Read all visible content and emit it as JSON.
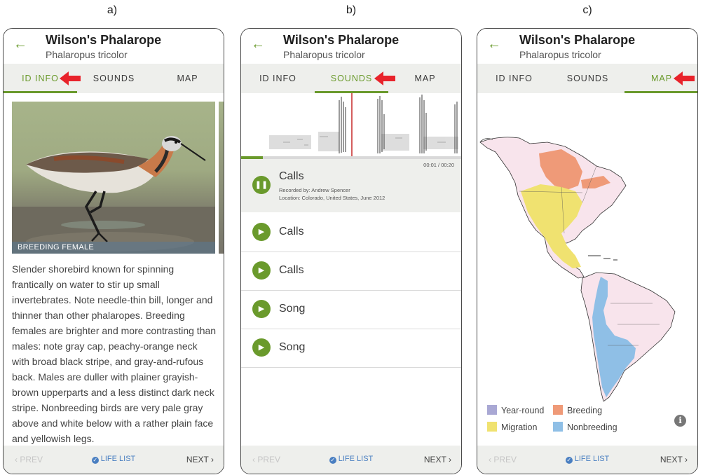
{
  "captions": [
    "a)",
    "b)",
    "c)"
  ],
  "bird": {
    "name": "Wilson's Phalarope",
    "scientific": "Phalaropus tricolor"
  },
  "icons": {
    "back": "←",
    "chevron_left": "‹",
    "chevron_right": "›",
    "check": "✓",
    "pause": "❚❚",
    "play": "▶",
    "info": "i"
  },
  "tabs": [
    "ID INFO",
    "SOUNDS",
    "MAP"
  ],
  "footer": {
    "prev": "PREV",
    "life_list": "LIFE LIST",
    "next": "NEXT"
  },
  "colors": {
    "accent": "#6a9a2c",
    "arrow": "#e8232b",
    "life_list": "#4a7fc1",
    "year_round": "#a9a8d4",
    "breeding": "#ef9a78",
    "migration": "#f0e270",
    "nonbreeding": "#8fbfe6"
  },
  "panel_a": {
    "photo_label": "BREEDING FEMALE",
    "description": "Slender shorebird known for spinning frantically on water to stir up small invertebrates. Note needle-thin bill, longer and thinner than other phalaropes. Breeding females are brighter and more contrasting than males: note gray cap, peachy-orange neck with broad black stripe, and gray-and-rufous back. Males are duller with plainer grayish-brown upperparts and a less distinct dark neck stripe. Nonbreeding birds are very pale gray above and white below with a rather plain face and yellowish legs."
  },
  "panel_b": {
    "playback": {
      "elapsed": "00:01",
      "total": "00:20",
      "progress": 0.1
    },
    "now_playing": {
      "title": "Calls",
      "recorded_by": "Recorded by: Andrew Spencer",
      "location": "Location: Colorado, United States, June 2012"
    },
    "sounds": [
      "Calls",
      "Calls",
      "Song",
      "Song"
    ]
  },
  "panel_c": {
    "legend": [
      "Year-round",
      "Breeding",
      "Migration",
      "Nonbreeding"
    ]
  }
}
